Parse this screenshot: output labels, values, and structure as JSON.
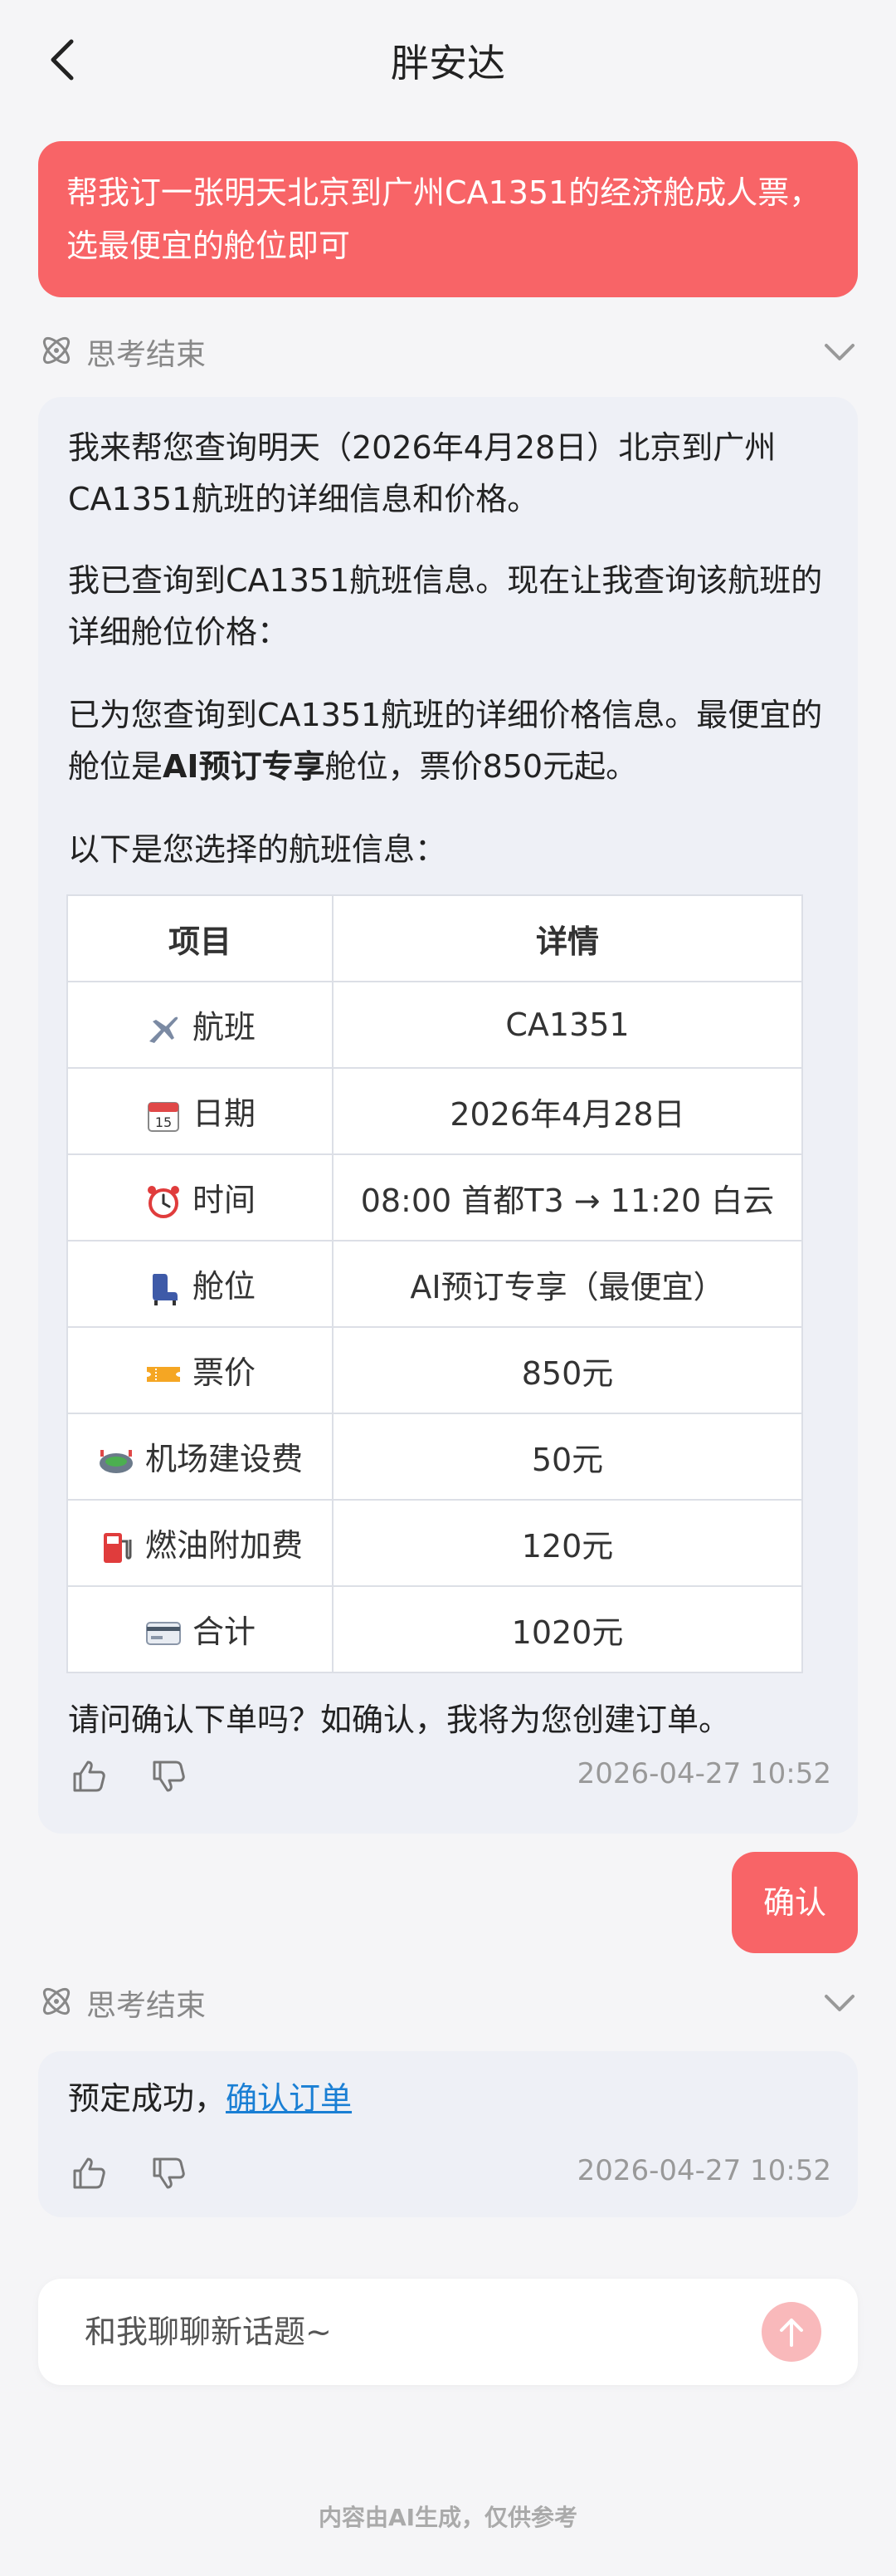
{
  "header": {
    "title": "胖安达"
  },
  "user_message": "帮我订一张明天北京到广州CA1351的经济舱成人票，选最便宜的舱位即可",
  "thinking_label": "思考结束",
  "ai_reply": {
    "p1": "我来帮您查询明天（2026年4月28日）北京到广州CA1351航班的详细信息和价格。",
    "p2": "我已查询到CA1351航班信息。现在让我查询该航班的详细舱位价格：",
    "p3_a": "已为您查询到CA1351航班的详细价格信息。最便宜的舱位是",
    "p3_bold": "AI预订专享",
    "p3_b": "舱位，票价850元起。",
    "p4": "以下是您选择的航班信息：",
    "table": {
      "headers": [
        "项目",
        "详情"
      ],
      "rows": [
        {
          "icon": "airplane-icon",
          "label": "航班",
          "value": "CA1351"
        },
        {
          "icon": "calendar-icon",
          "label": "日期",
          "value": "2026年4月28日"
        },
        {
          "icon": "alarm-clock-icon",
          "label": "时间",
          "value": "08:00 首都T3 → 11:20 白云"
        },
        {
          "icon": "seat-icon",
          "label": "舱位",
          "value": "AI预订专享（最便宜）"
        },
        {
          "icon": "ticket-icon",
          "label": "票价",
          "value": "850元"
        },
        {
          "icon": "stadium-icon",
          "label": "机场建设费",
          "value": "50元"
        },
        {
          "icon": "fuel-pump-icon",
          "label": "燃油附加费",
          "value": "120元"
        },
        {
          "icon": "credit-card-icon",
          "label": "合计",
          "value": "1020元"
        }
      ]
    },
    "p5": "请问确认下单吗？如确认，我将为您创建订单。",
    "timestamp": "2026-04-27 10:52"
  },
  "confirm_message": "确认",
  "ai_reply2": {
    "text": "预定成功，",
    "link": "确认订单",
    "timestamp": "2026-04-27 10:52"
  },
  "input": {
    "placeholder": "和我聊聊新话题~"
  },
  "footer_note": "内容由AI生成，仅供参考",
  "colors": {
    "accent": "#f86467",
    "send_button": "#f9b9bb",
    "link": "#1a7fd4"
  }
}
